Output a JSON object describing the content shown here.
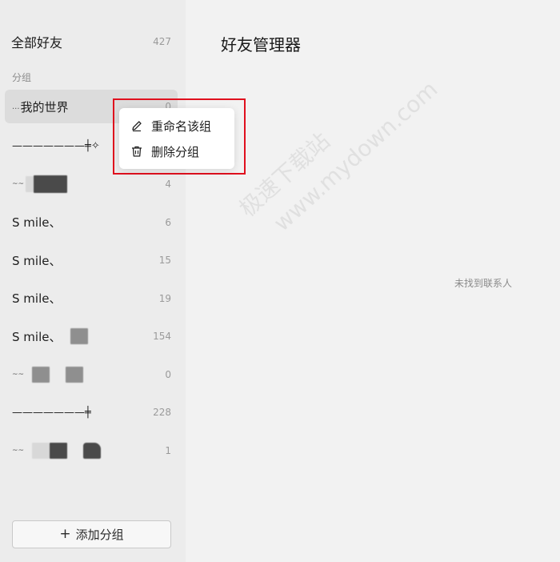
{
  "sidebar": {
    "all_friends": {
      "label": "全部好友",
      "count": "427"
    },
    "section_label": "分组",
    "groups": [
      {
        "name": "我的世界",
        "prefix": "...",
        "count": "0",
        "selected": true
      },
      {
        "name": "———————╪✧",
        "count": ""
      },
      {
        "name": "",
        "count": "4"
      },
      {
        "name": "S mile、",
        "count": "6"
      },
      {
        "name": "S mile、",
        "count": "15"
      },
      {
        "name": "S mile、",
        "count": "19"
      },
      {
        "name": "S mile、",
        "count": "154"
      },
      {
        "name": "",
        "count": "0"
      },
      {
        "name": "———————╪",
        "count": "228"
      },
      {
        "name": "",
        "count": "1"
      }
    ],
    "add_group_label": "添加分组"
  },
  "main": {
    "title": "好友管理器",
    "empty_text": "未找到联系人",
    "watermark_line1": "极速下载站",
    "watermark_line2": "www.mydown.com"
  },
  "context_menu": {
    "items": [
      {
        "label": "重命名该组",
        "icon": "pencil-icon"
      },
      {
        "label": "删除分组",
        "icon": "trash-icon"
      }
    ]
  },
  "colors": {
    "highlight": "#e0101e",
    "sidebar_bg": "#ececec",
    "main_bg": "#f2f2f2"
  }
}
